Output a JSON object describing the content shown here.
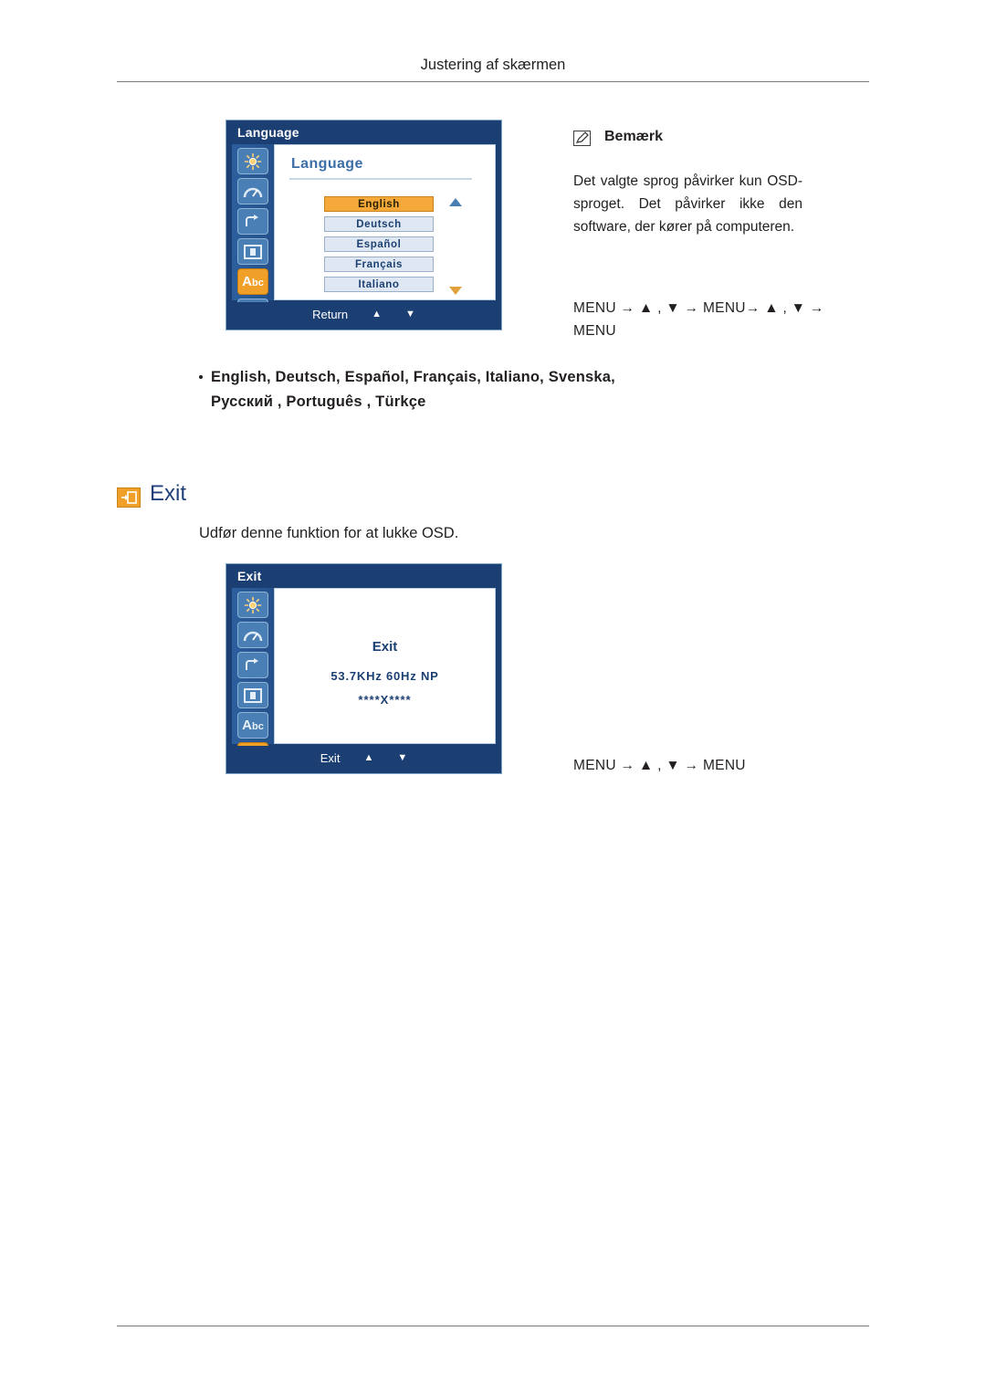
{
  "page": {
    "header_title": "Justering af skærmen"
  },
  "language_osd": {
    "title": "Language",
    "heading": "Language",
    "items": [
      {
        "label": "English",
        "selected": true
      },
      {
        "label": "Deutsch",
        "selected": false
      },
      {
        "label": "Español",
        "selected": false
      },
      {
        "label": "Français",
        "selected": false
      },
      {
        "label": "Italiano",
        "selected": false
      }
    ],
    "footer_label": "Return",
    "up_arrow": "▲",
    "down_arrow": "▼",
    "sidebar_icons": [
      "brightness-icon",
      "gauge-icon",
      "reset-icon",
      "picture-icon",
      "language-icon",
      "exit-icon"
    ],
    "sidebar_selected_index": 4
  },
  "note": {
    "heading": "Bemærk",
    "body": "Det valgte sprog påvirker kun OSD-sproget. Det påvirker ikke den software, der kører på computeren.",
    "keys": "MENU → ▲ , ▼ → MENU→ ▲ ,  ▼ → MENU"
  },
  "language_list_note": {
    "line1": "English, Deutsch, Español, Français,  Italiano, Svenska,",
    "line2": "Русский , Português , Türkçe"
  },
  "exit_section": {
    "title": "Exit",
    "description": "Udfør denne funktion for at lukke OSD.",
    "keys": "MENU → ▲ , ▼ → MENU"
  },
  "exit_osd": {
    "title": "Exit",
    "screen_title": "Exit",
    "frequency": "53.7KHz 60Hz NP",
    "stars": "****X****",
    "footer_label": "Exit",
    "up_arrow": "▲",
    "down_arrow": "▼",
    "sidebar_selected_index": 5
  }
}
